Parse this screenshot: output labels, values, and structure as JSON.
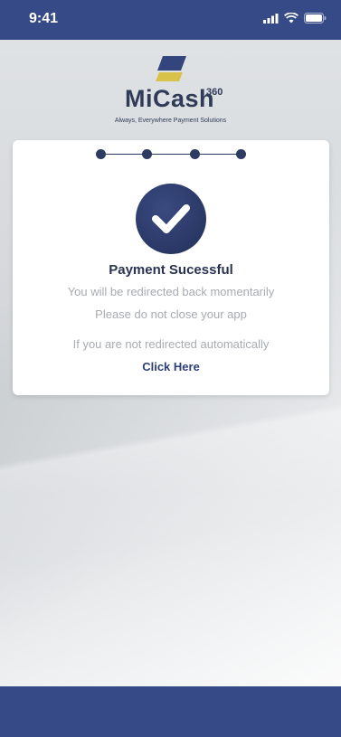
{
  "status_bar": {
    "time": "9:41"
  },
  "brand": {
    "name": "MiCash",
    "superscript": "360",
    "tagline": "Always, Everywhere Payment Solutions"
  },
  "progress": {
    "steps": 4,
    "completed": 4
  },
  "message": {
    "title": "Payment Sucessful",
    "line1": "You will be redirected back momentarily",
    "line2": "Please do not close your app",
    "line3": "If you are not redirected automatically",
    "link": "Click Here"
  },
  "colors": {
    "primary": "#354a86",
    "text_dark": "#2a3352",
    "text_muted": "#a7abb3",
    "logo_gold": "#d9c24a"
  }
}
